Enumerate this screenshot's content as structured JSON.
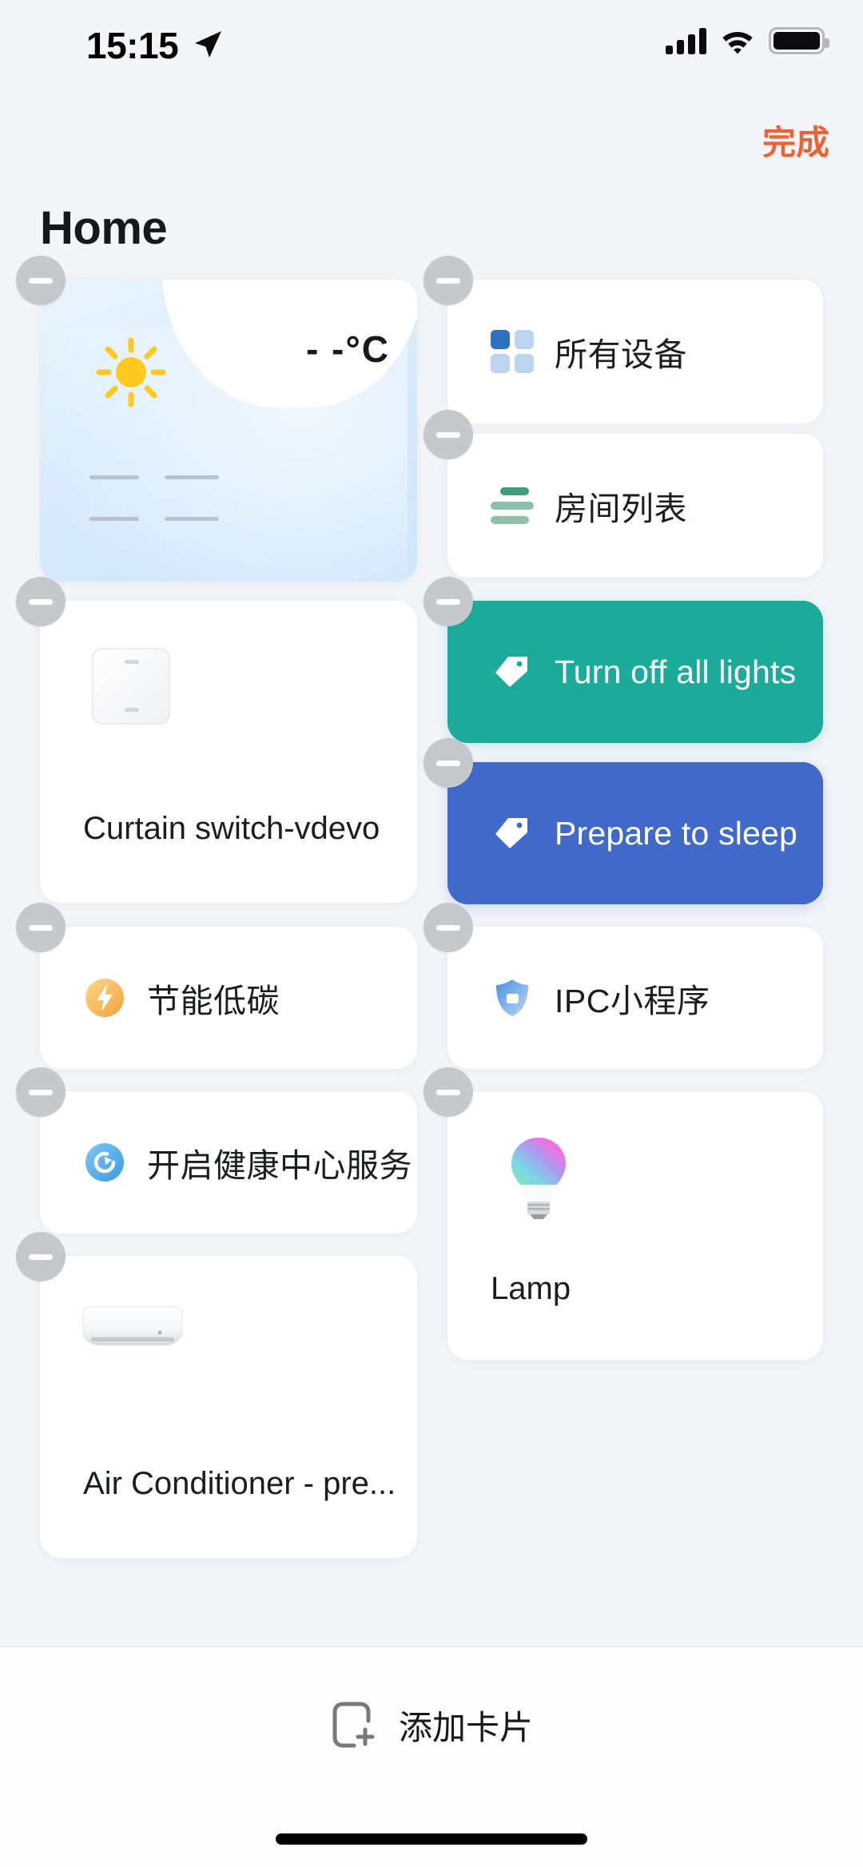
{
  "status_bar": {
    "time": "15:15",
    "location_icon": "location-arrow-icon",
    "cellular_icon": "cellular-signal-icon",
    "wifi_icon": "wifi-icon",
    "battery_icon": "battery-full-icon"
  },
  "header": {
    "done_label": "完成",
    "done_color": "#ef6132",
    "page_title": "Home"
  },
  "cards": {
    "weather": {
      "name": "weather-card",
      "temperature": "- -°C",
      "weather_icon": "sun-icon",
      "placeholder_dashes": "-- --"
    },
    "all_devices": {
      "label": "所有设备",
      "icon": "grid-squares-icon"
    },
    "room_list": {
      "label": "房间列表",
      "icon": "list-lines-icon"
    },
    "curtain_switch": {
      "name": "Curtain switch-vdevo",
      "icon": "wall-switch-icon"
    },
    "scene_lights": {
      "label": "Turn off all lights",
      "icon": "tag-icon",
      "color": "#1cab9b"
    },
    "scene_sleep": {
      "label": "Prepare to sleep",
      "icon": "tag-icon",
      "color": "#4169c9"
    },
    "energy_saving": {
      "label": "节能低碳",
      "icon": "lightning-bolt-icon"
    },
    "ipc_miniapp": {
      "label": "IPC小程序",
      "icon": "camera-shield-icon"
    },
    "health_center": {
      "label": "开启健康中心服务",
      "icon": "health-spiral-icon"
    },
    "lamp": {
      "name": "Lamp",
      "icon": "rgb-bulb-icon"
    },
    "air_conditioner": {
      "name": "Air Conditioner - pre...",
      "icon": "air-conditioner-icon"
    }
  },
  "bottom_bar": {
    "add_card_label": "添加卡片",
    "add_card_icon": "add-card-plus-icon"
  }
}
